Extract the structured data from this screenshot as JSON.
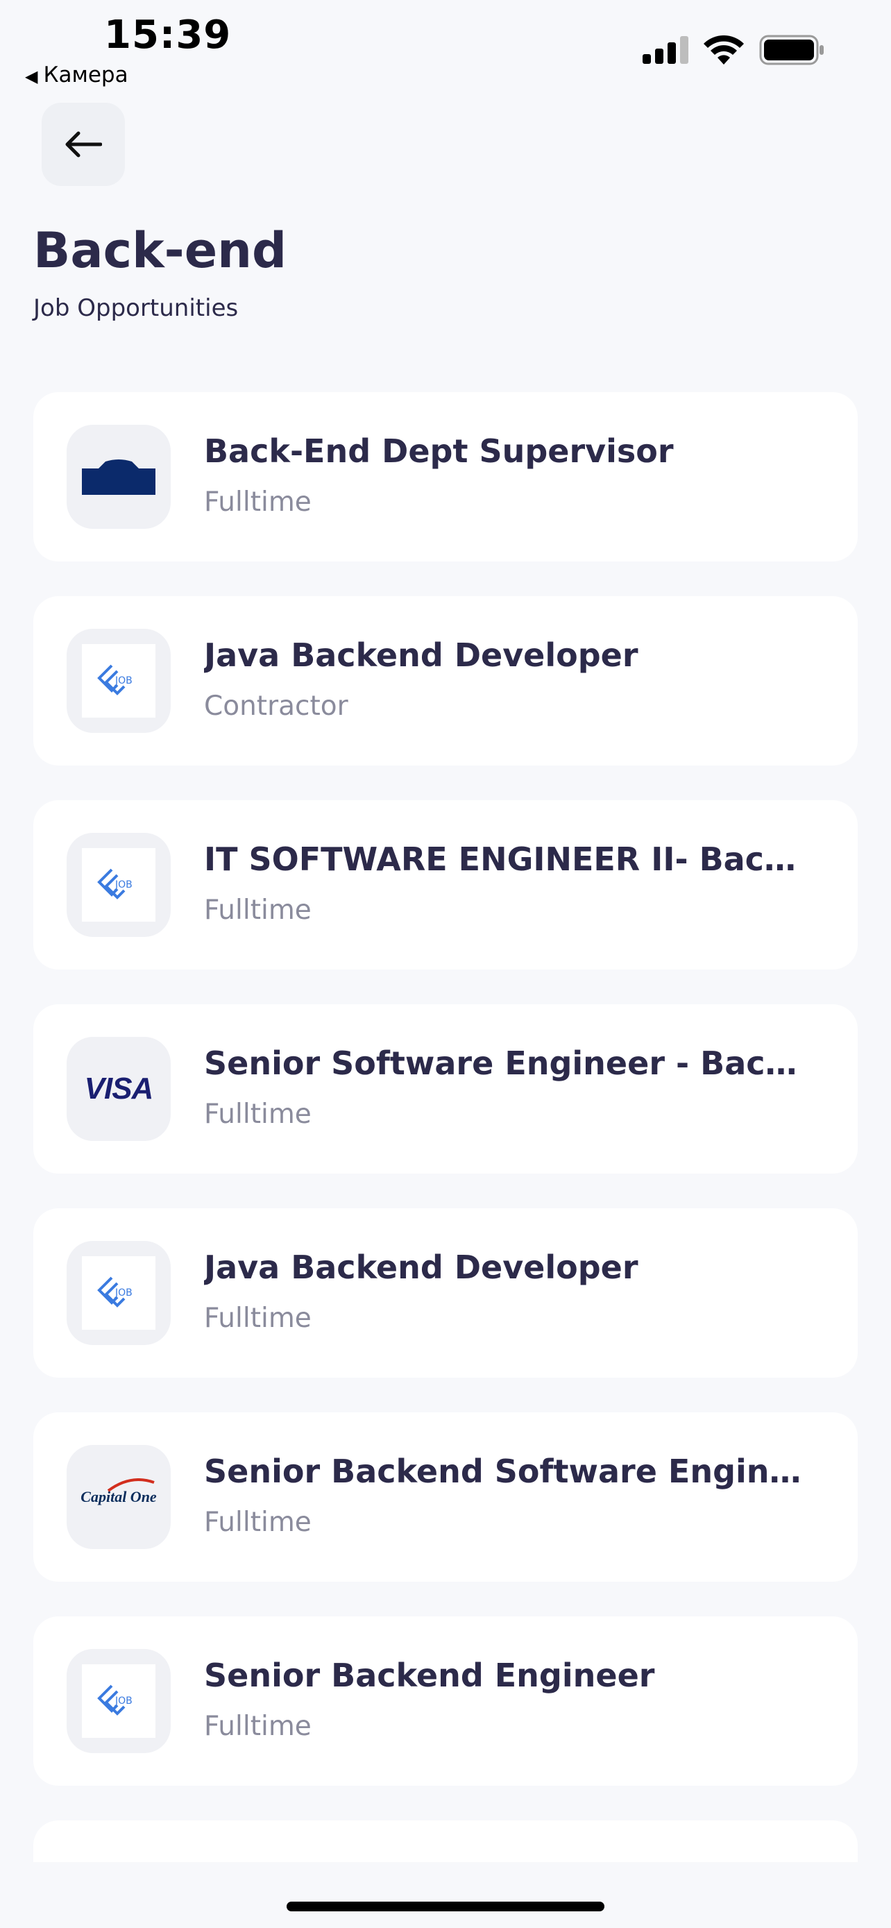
{
  "status_bar": {
    "time": "15:39",
    "back_app_label": "Камера"
  },
  "header": {
    "title": "Back-end",
    "subtitle": "Job Opportunities"
  },
  "jobs": [
    {
      "title": "Back-End Dept Supervisor",
      "type": "Fulltime",
      "logo": "building-logo"
    },
    {
      "title": "Java Backend Developer",
      "type": "Contractor",
      "logo": "job-logo"
    },
    {
      "title": "IT SOFTWARE ENGINEER II- Back-End",
      "type": "Fulltime",
      "logo": "job-logo"
    },
    {
      "title": "Senior Software Engineer - Back-End",
      "type": "Fulltime",
      "logo": "visa-logo",
      "logo_text": "VISA"
    },
    {
      "title": "Java Backend Developer",
      "type": "Fulltime",
      "logo": "job-logo"
    },
    {
      "title": "Senior Backend Software Engineer",
      "type": "Fulltime",
      "logo": "capital-one-logo",
      "logo_text": "Capital One"
    },
    {
      "title": "Senior Backend Engineer",
      "type": "Fulltime",
      "logo": "job-logo"
    }
  ],
  "logo_placeholder_text": "JOB",
  "colors": {
    "background": "#f7f8fb",
    "card": "#ffffff",
    "title": "#2c2a4a",
    "subtle": "#8a8b9c",
    "job_logo_blue": "#3b7be0"
  }
}
